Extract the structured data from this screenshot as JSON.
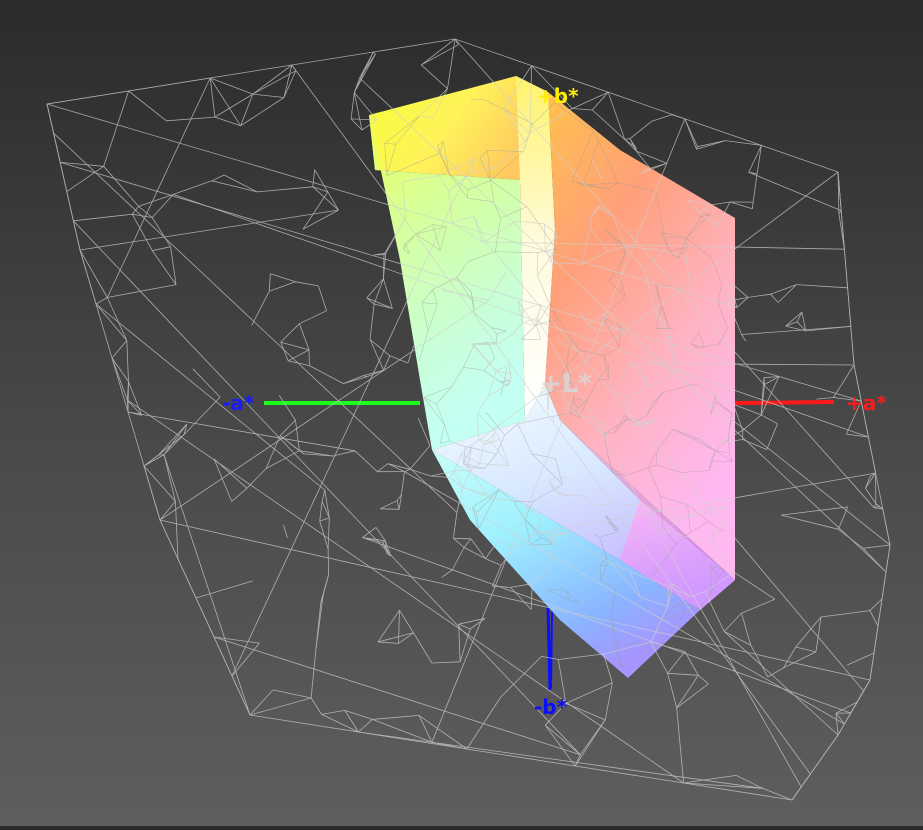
{
  "viewer": {
    "axes": {
      "plus_a": "+a*",
      "minus_a": "-a*",
      "plus_b": "+b*",
      "minus_b": "-b*",
      "plus_l": "+L*"
    },
    "colors": {
      "background_top": "#2b2b2b",
      "background_bottom": "#5e5e5e",
      "wireframe": "#d0d0d0",
      "axis_plus_a": "#ff1a1a",
      "axis_minus_a": "#1aff1a",
      "axis_plus_b": "#ffee00",
      "axis_minus_b": "#0d0dff",
      "axis_plus_l": "#d8d8d8"
    }
  }
}
